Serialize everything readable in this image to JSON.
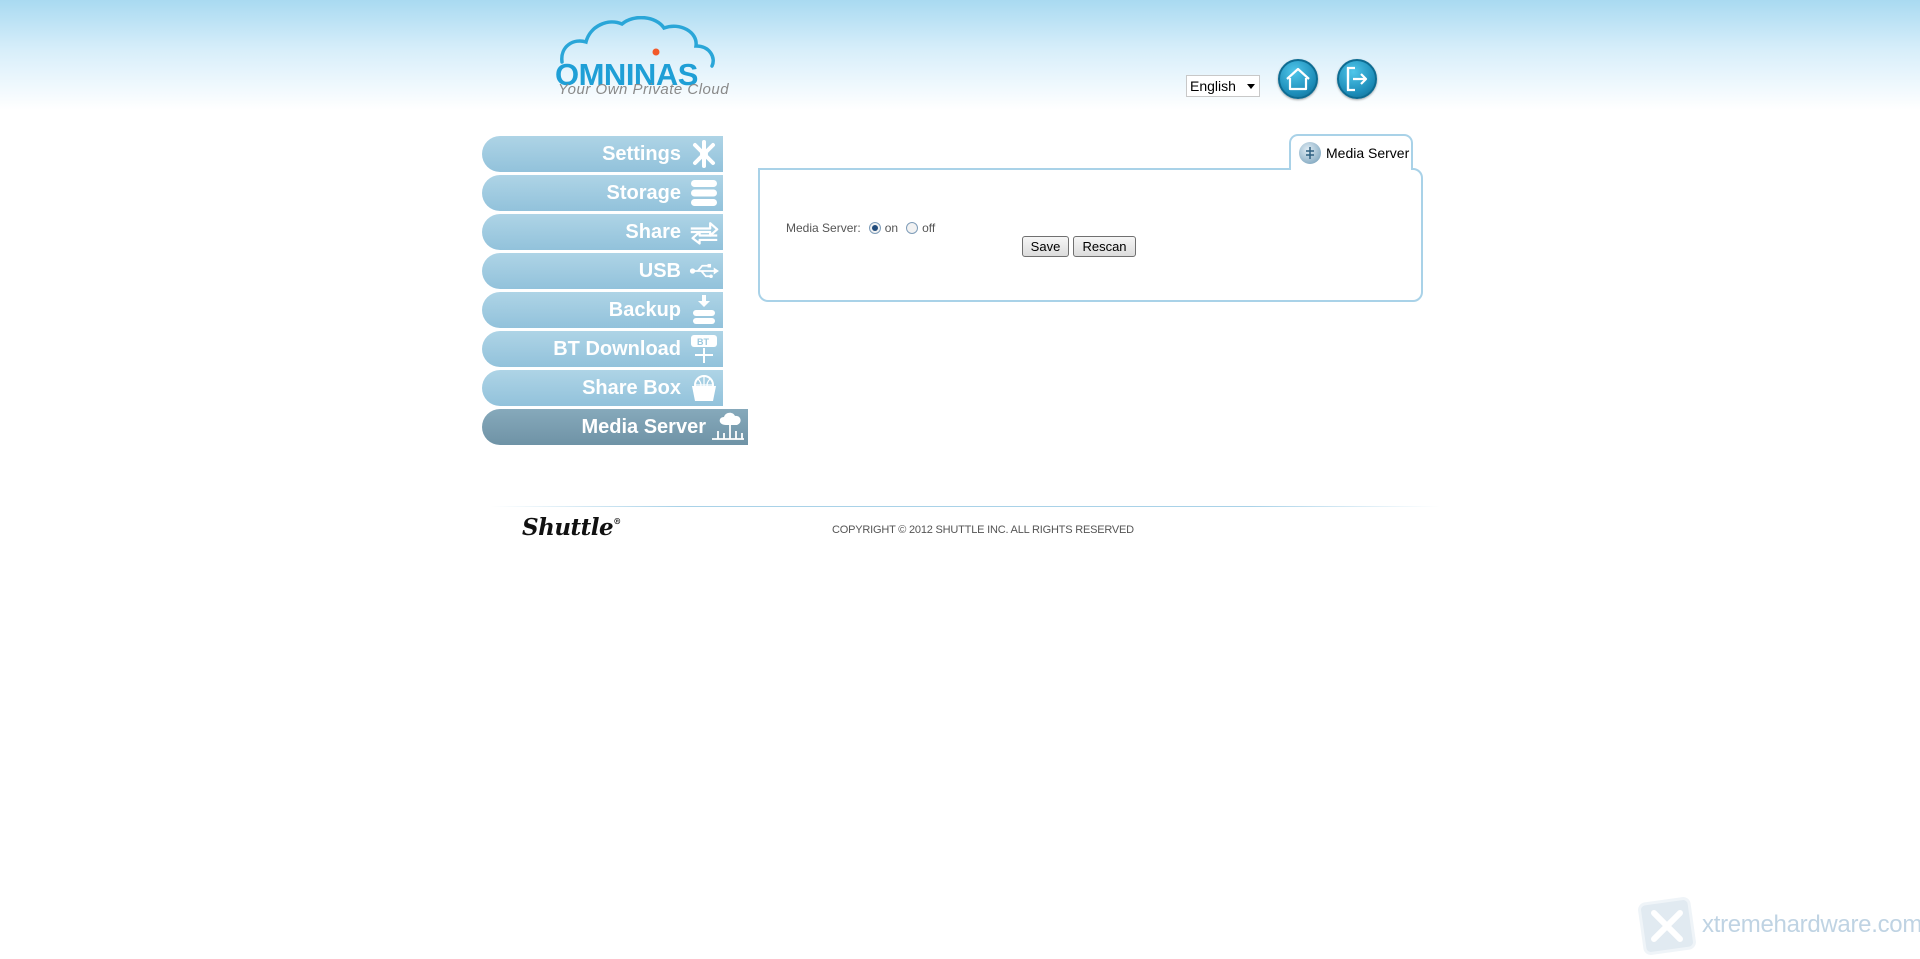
{
  "header": {
    "logo_text": "OMNINAS",
    "logo_slogan": "Your Own Private Cloud",
    "language": "English",
    "home_icon": "home-icon",
    "logout_icon": "logout-icon"
  },
  "sidebar": {
    "items": [
      {
        "label": "Settings",
        "icon": "tools-icon"
      },
      {
        "label": "Storage",
        "icon": "storage-icon"
      },
      {
        "label": "Share",
        "icon": "share-arrows-icon"
      },
      {
        "label": "USB",
        "icon": "usb-icon"
      },
      {
        "label": "Backup",
        "icon": "backup-icon"
      },
      {
        "label": "BT Download",
        "icon": "bt-download-icon"
      },
      {
        "label": "Share Box",
        "icon": "share-box-icon"
      },
      {
        "label": "Media Server",
        "icon": "media-server-icon"
      }
    ],
    "active_index": 7
  },
  "main": {
    "tab_label": "Media Server",
    "media_server": {
      "label": "Media Server:",
      "options": [
        "on",
        "off"
      ],
      "selected": "on"
    },
    "buttons": {
      "save": "Save",
      "rescan": "Rescan"
    }
  },
  "footer": {
    "brand": "Shuttle",
    "brand_mark": "®",
    "copyright": "COPYRIGHT © 2012 SHUTTLE INC. ALL RIGHTS RESERVED"
  },
  "watermark": {
    "text": "xtremehardware.com"
  },
  "colors": {
    "nav": "#9cc8de",
    "nav_active": "#7699ad",
    "panel_border": "#a9d2e8",
    "button_blue": "#1d8db9"
  }
}
